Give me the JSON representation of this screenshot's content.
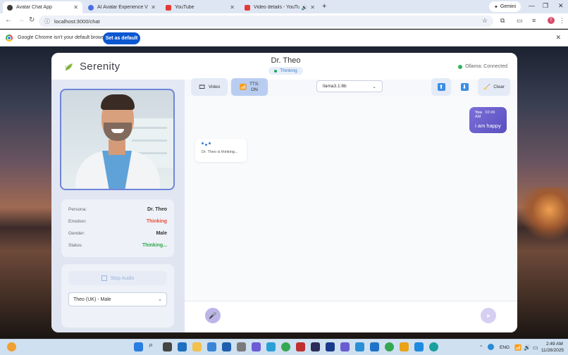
{
  "browser": {
    "tabs": [
      {
        "title": "Avatar Chat App",
        "active": true
      },
      {
        "title": "AI Avatar Experience Video Pro",
        "active": false
      },
      {
        "title": "YouTube",
        "active": false
      },
      {
        "title": "Video details - YouTube St",
        "active": false
      }
    ],
    "gemini_label": "Gemini",
    "url": "localhost:3000/chat",
    "infobar_message": "Google Chrome isn't your default browser",
    "set_default_label": "Set as default"
  },
  "app": {
    "brand_name": "Serenity",
    "doctor_name": "Dr. Theo",
    "status_pill": "Thinking",
    "ollama_status": "Ollama: Connected",
    "info": [
      {
        "label": "Persona:",
        "value": "Dr. Theo"
      },
      {
        "label": "Emotion:",
        "value": "Thinking"
      },
      {
        "label": "Gender:",
        "value": "Male"
      },
      {
        "label": "Status:",
        "value": "Thinking..."
      }
    ],
    "stop_audio_label": "Stop Audio",
    "voice_selected": "Theo (UK) - Male",
    "toolbar": {
      "video_label": "Video",
      "tts_label_line1": "TTS:",
      "tts_label_line2": "ON",
      "model_selected": "llama3.1:8b",
      "clear_label": "Clear"
    },
    "messages": {
      "user_sender": "You",
      "user_time": "02:49 AM",
      "user_text": "i am happy",
      "bot_text": "Dr. Theo is thinking..."
    }
  },
  "taskbar": {
    "lang": "ENG",
    "time": "2:49 AM",
    "date": "11/28/2025"
  },
  "colors": {
    "accent": "#6e86d8",
    "user_bubble": "#6a5fcf",
    "emotion": "#e24f3c",
    "status_ok": "#2aa84a"
  }
}
